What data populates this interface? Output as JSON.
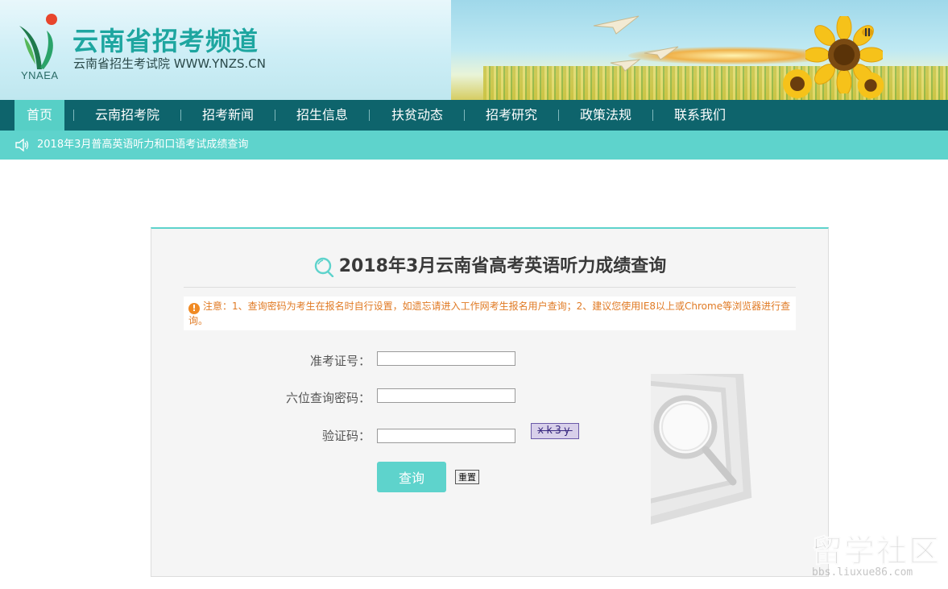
{
  "header": {
    "logo_abbr": "YNAEA",
    "title": "云南省招考频道",
    "subtitle": "云南省招生考试院 WWW.YNZS.CN"
  },
  "nav": {
    "items": [
      {
        "label": "首页",
        "active": true
      },
      {
        "label": "云南招考院"
      },
      {
        "label": "招考新闻"
      },
      {
        "label": "招生信息"
      },
      {
        "label": "扶贫动态"
      },
      {
        "label": "招考研究"
      },
      {
        "label": "政策法规"
      },
      {
        "label": "联系我们"
      }
    ],
    "separator": "|"
  },
  "ticker": {
    "icon": "speaker-icon",
    "text": "2018年3月普高英语听力和口语考试成绩查询"
  },
  "query_card": {
    "title": "2018年3月云南省高考英语听力成绩查询",
    "title_icon": "search-icon",
    "notice": "注意：1、查询密码为考生在报名时自行设置，如遗忘请进入工作网考生报名用户查询；2、建议您使用IE8以上或Chrome等浏览器进行查询。",
    "notice_icon": "!",
    "fields": {
      "exam_no_label": "准考证号：",
      "exam_no_value": "",
      "password_label": "六位查询密码：",
      "password_value": "",
      "captcha_label": "验证码：",
      "captcha_value": ""
    },
    "captcha_text": "xk3y",
    "submit_label": "查询",
    "reset_label": "重置"
  },
  "watermark": {
    "big": "留学社区",
    "small": "bbs.liuxue86.com"
  },
  "colors": {
    "nav_bg": "#0e646c",
    "accent": "#5ed3cc",
    "title_green": "#1ea6a0",
    "notice_orange": "#e07a24"
  }
}
